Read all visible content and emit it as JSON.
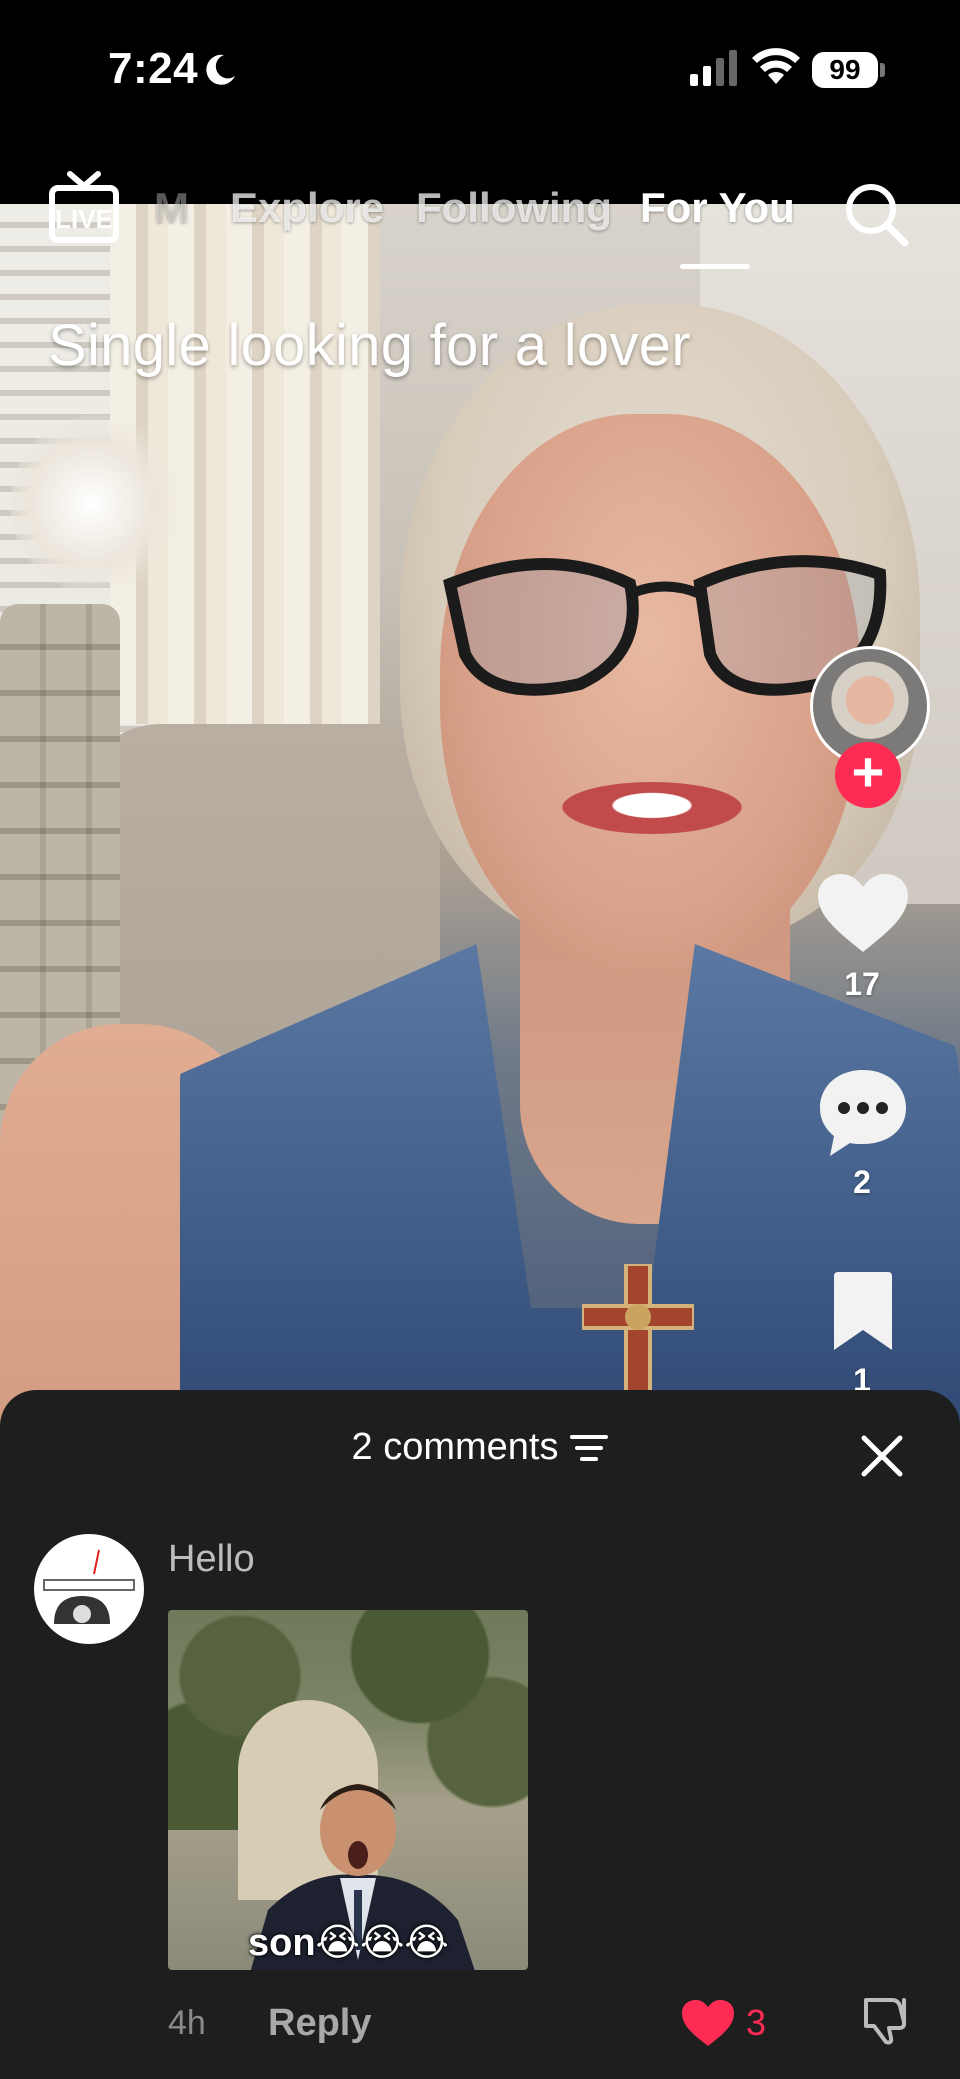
{
  "status_bar": {
    "time": "7:24",
    "battery": "99",
    "icons": [
      "moon-icon",
      "signal-icon",
      "wifi-icon",
      "battery-icon"
    ]
  },
  "top_nav": {
    "live_label": "LIVE",
    "tabs": [
      {
        "label": "M",
        "state": "faded"
      },
      {
        "label": "Explore",
        "state": "inactive"
      },
      {
        "label": "Following",
        "state": "inactive"
      },
      {
        "label": "For You",
        "state": "active"
      }
    ],
    "search_icon": "search-icon"
  },
  "video": {
    "caption": "Single looking for a lover"
  },
  "right_rail": {
    "follow_icon": "plus-icon",
    "likes": "17",
    "comments": "2",
    "saves": "1",
    "like_icon": "heart-icon",
    "comment_icon": "comment-bubble-icon",
    "save_icon": "bookmark-icon"
  },
  "comments_sheet": {
    "title": "2 comments",
    "filter_icon": "filter-icon",
    "close_icon": "close-icon",
    "comment": {
      "text": "Hello",
      "gif_caption": "son😭😭😭",
      "time": "4h",
      "reply_label": "Reply",
      "like_count": "3"
    }
  },
  "colors": {
    "accent": "#fe2c55",
    "sheet_bg": "#1e1e1e"
  }
}
